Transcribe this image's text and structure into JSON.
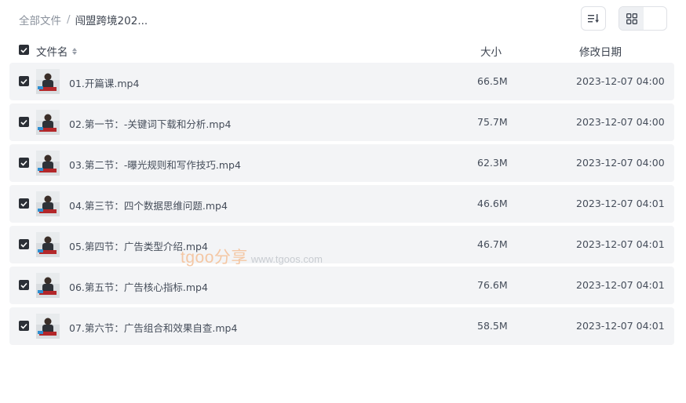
{
  "breadcrumb": {
    "root": "全部文件",
    "separator": "/",
    "current": "闯盟跨境202..."
  },
  "toolbar": {
    "sort_icon": "sort-icon",
    "list_view_icon": "list-view-icon",
    "grid_view_icon": "grid-view-icon",
    "active_view": "grid"
  },
  "header": {
    "name": "文件名",
    "size": "大小",
    "date": "修改日期",
    "all_selected": true
  },
  "files": [
    {
      "name": "01.开篇课.mp4",
      "size": "66.5M",
      "date": "2023-12-07 04:00",
      "selected": true
    },
    {
      "name": "02.第一节：-关键词下载和分析.mp4",
      "size": "75.7M",
      "date": "2023-12-07 04:00",
      "selected": true
    },
    {
      "name": "03.第二节：-曝光规则和写作技巧.mp4",
      "size": "62.3M",
      "date": "2023-12-07 04:00",
      "selected": true
    },
    {
      "name": "04.第三节：四个数据思维问题.mp4",
      "size": "46.6M",
      "date": "2023-12-07 04:01",
      "selected": true
    },
    {
      "name": "05.第四节：广告类型介绍.mp4",
      "size": "46.7M",
      "date": "2023-12-07 04:01",
      "selected": true
    },
    {
      "name": "06.第五节：广告核心指标.mp4",
      "size": "76.6M",
      "date": "2023-12-07 04:01",
      "selected": true
    },
    {
      "name": "07.第六节：广告组合和效果自查.mp4",
      "size": "58.5M",
      "date": "2023-12-07 04:01",
      "selected": true
    }
  ],
  "watermark": {
    "brand": "tgoo分享",
    "url": "www.tgoos.com"
  },
  "colors": {
    "row_background": "#f3f4f6",
    "checkbox": "#2b2f36",
    "text": "#454d5a",
    "watermark": "#f4c7a4"
  }
}
